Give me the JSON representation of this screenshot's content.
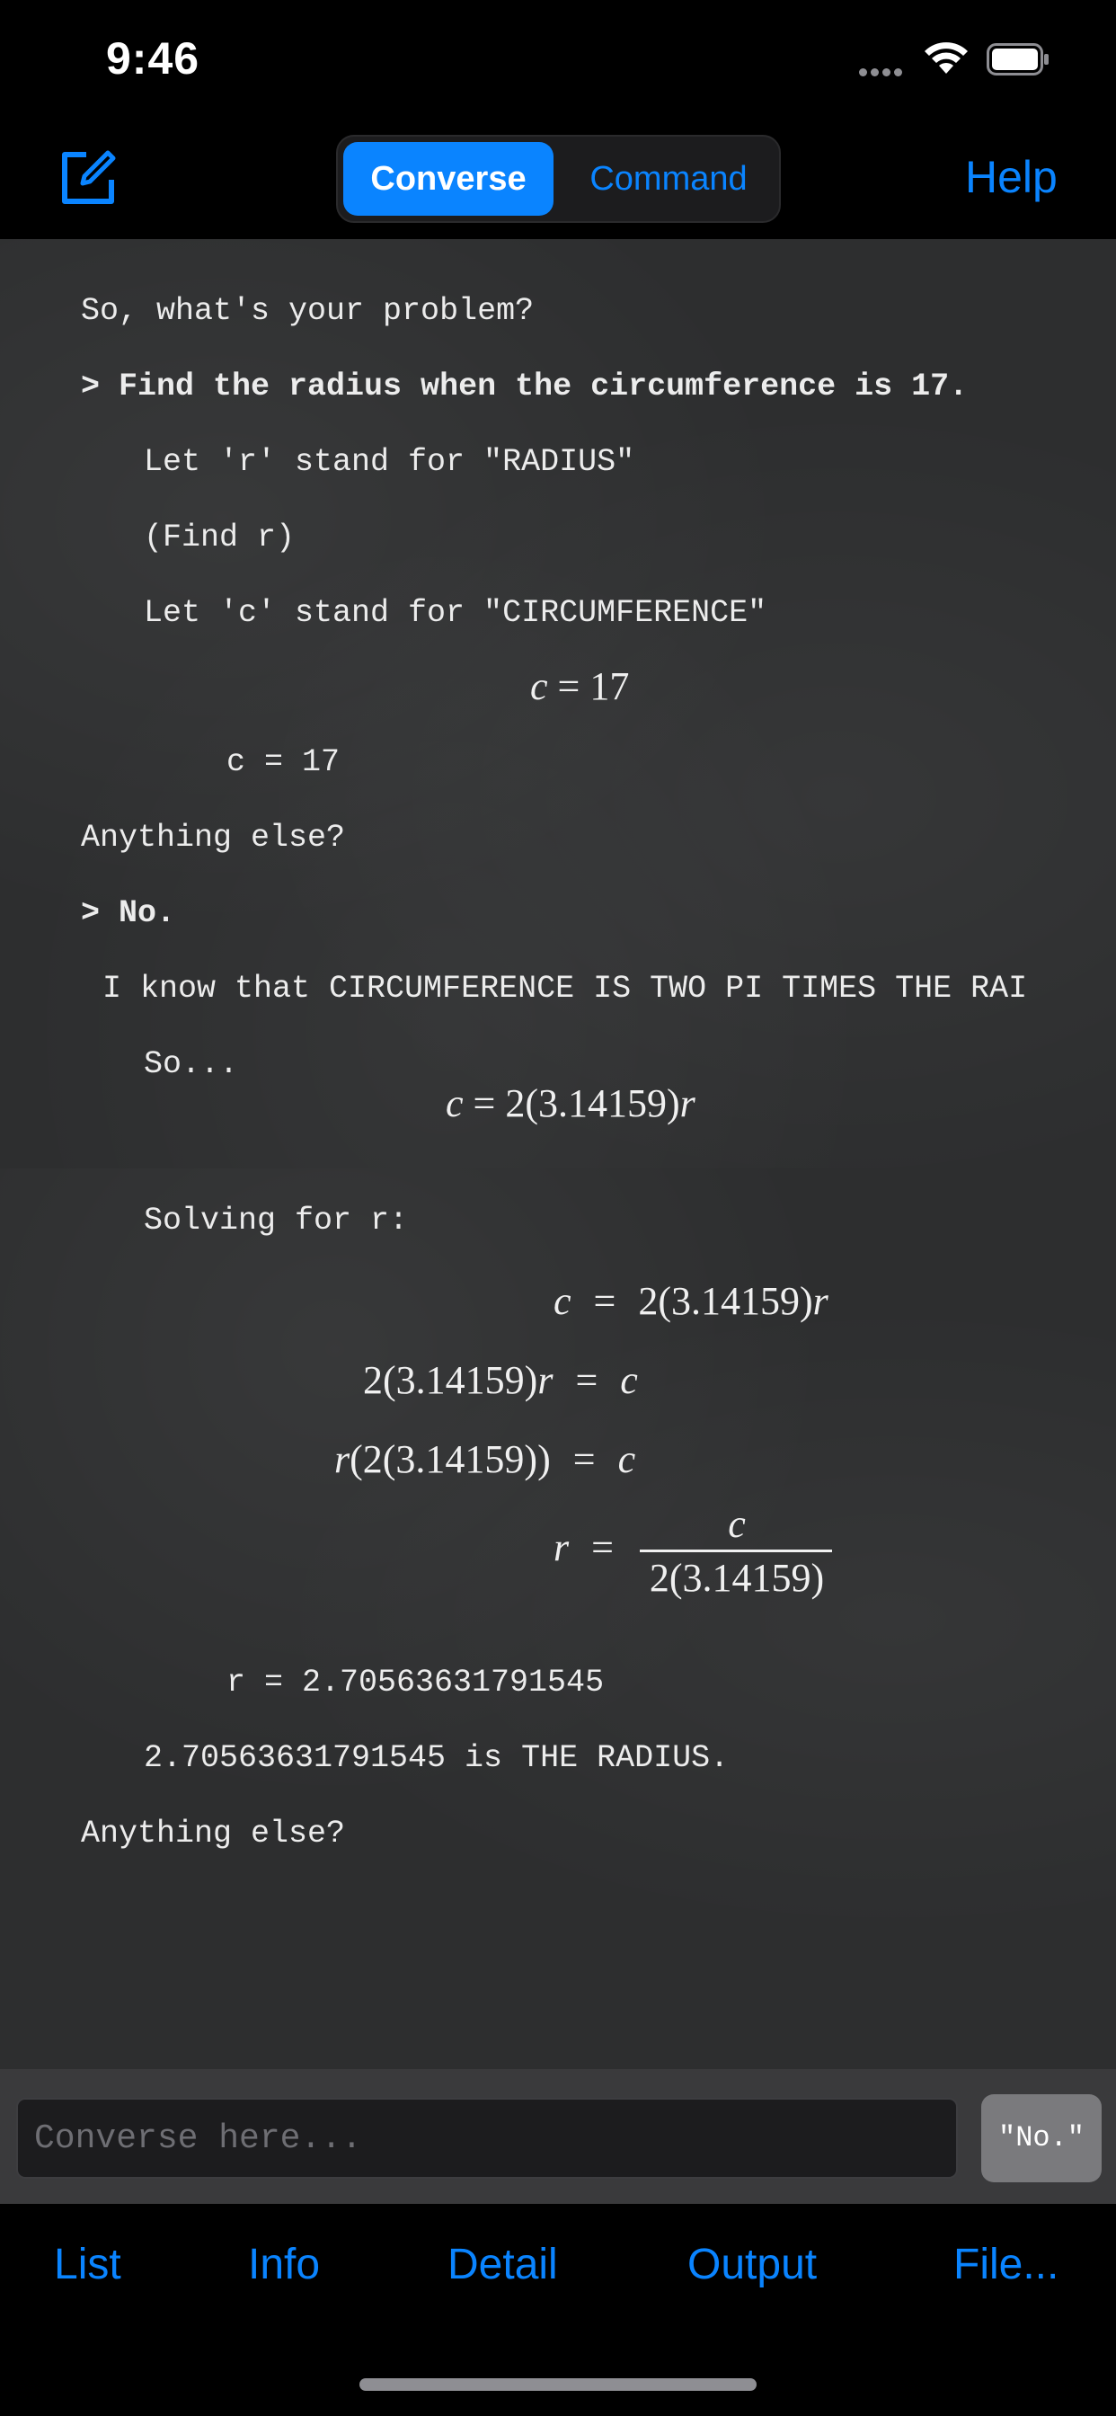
{
  "status_bar": {
    "time": "9:46"
  },
  "nav": {
    "segments": [
      "Converse",
      "Command"
    ],
    "selected_segment": "Converse",
    "help_label": "Help"
  },
  "transcript": {
    "prompt_open": "So, what's your problem?",
    "user_input_1": "> Find the radius when the circumference is 17.",
    "let_r": "Let 'r' stand for \"RADIUS\"",
    "find_r": "(Find r)",
    "let_c": "Let 'c' stand for \"CIRCUMFERENCE\"",
    "c_value": "c = 17",
    "anything_else_1": "Anything else?",
    "user_input_2": "> No.",
    "fact": "I know that CIRCUMFERENCE IS TWO PI TIMES THE RAI",
    "so": "So...",
    "solving": "Solving for r:",
    "r_value": "r = 2.70563631791545",
    "answer": "2.70563631791545 is THE RADIUS.",
    "anything_else_2": "Anything else?"
  },
  "math": {
    "c_equals_17": {
      "lhs": "c",
      "rhs": "= 17"
    },
    "formula": {
      "lhs": "c",
      "rhs": "= 2(3.14159)",
      "var": "r"
    },
    "step1": {
      "lhs": "c",
      "eq": "=",
      "rhs": "2(3.14159)",
      "var": "r"
    },
    "step2": {
      "lhs": "2(3.14159)",
      "var": "r",
      "eq": "=",
      "rhs": "c"
    },
    "step3": {
      "var": "r",
      "lhs": "(2(3.14159))",
      "eq": "=",
      "rhs": "c"
    },
    "step4": {
      "lhs": "r",
      "eq": "=",
      "numerator": "c",
      "denominator": "2(3.14159)"
    }
  },
  "input": {
    "placeholder": "Converse here...",
    "quick_reply": "\"No.\""
  },
  "toolbar": {
    "items": [
      "List",
      "Info",
      "Detail",
      "Output",
      "File..."
    ]
  },
  "colors": {
    "accent": "#0a84ff",
    "board": "#2d2e2f"
  },
  "icons": [
    "compose-icon",
    "wifi-icon",
    "battery-icon",
    "signal-icon"
  ]
}
